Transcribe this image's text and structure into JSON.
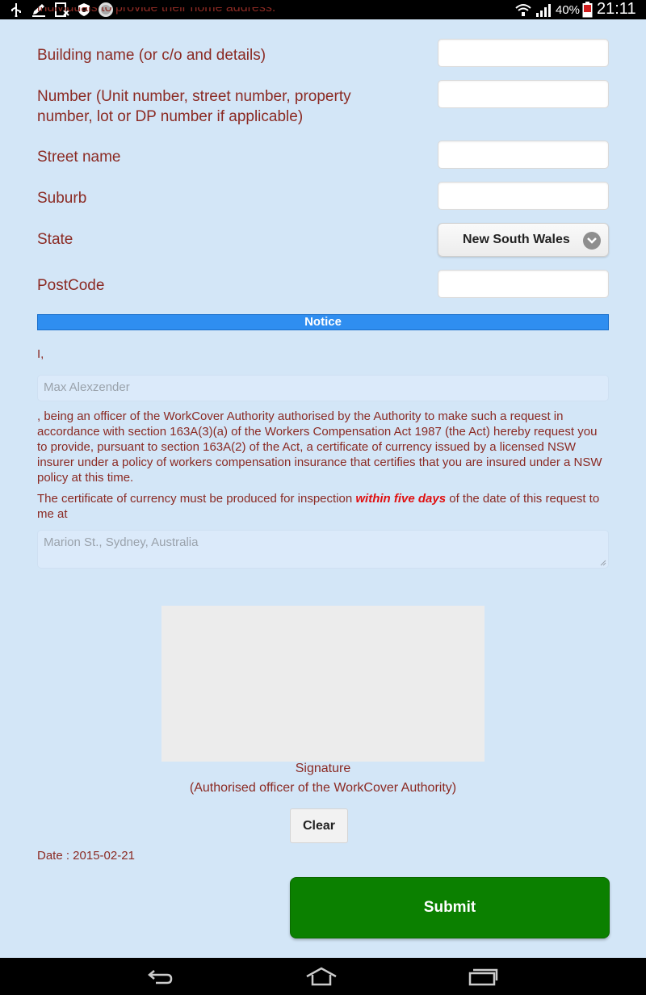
{
  "status_bar": {
    "icons_left": [
      "usb-icon",
      "pencil-icon",
      "no-sim-icon",
      "shield-icon",
      "app-badge-icon"
    ],
    "icons_right": [
      "wifi-icon",
      "signal-icon",
      "battery-icon"
    ],
    "battery_percent": "40%",
    "time": "21:11"
  },
  "form": {
    "clipped_text": "individuals to provide their home address.",
    "fields": {
      "building_label": "Building name (or c/o and details)",
      "number_label_line1": "Number (Unit number, street number, property",
      "number_label_line2": "number, lot or DP number if applicable)",
      "street_label": "Street name",
      "suburb_label": "Suburb",
      "state_label": "State",
      "postcode_label": "PostCode"
    },
    "state_selected": "New South Wales"
  },
  "notice": {
    "title": "Notice",
    "i_label": "I,",
    "officer_placeholder": "Max Alexzender",
    "paragraph": ", being an officer of the WorkCover Authority authorised by the Authority to make such a request in accordance with section 163A(3)(a) of the Workers Compensation Act 1987 (the Act) hereby request you to provide, pursuant to section 163A(2) of the Act, a certificate of currency issued by a licensed NSW insurer under a policy of workers compensation insurance that certifies that you are insured under a NSW policy at this time.",
    "cert_before": "The certificate of currency must be produced for inspection ",
    "cert_emphasis": "within five days",
    "cert_after": " of the date of this request to me at",
    "address_placeholder": "Marion St., Sydney, Australia"
  },
  "signature": {
    "caption": "Signature",
    "subcaption": "(Authorised officer of the WorkCover Authority)",
    "clear_label": "Clear"
  },
  "date_text": "Date : 2015-02-21",
  "submit_label": "Submit",
  "colors": {
    "background": "#d3e6f7",
    "label": "#8b2a23",
    "notice_bar": "#2f8ef0",
    "submit": "#0b8000",
    "emphasis": "#e01010"
  }
}
